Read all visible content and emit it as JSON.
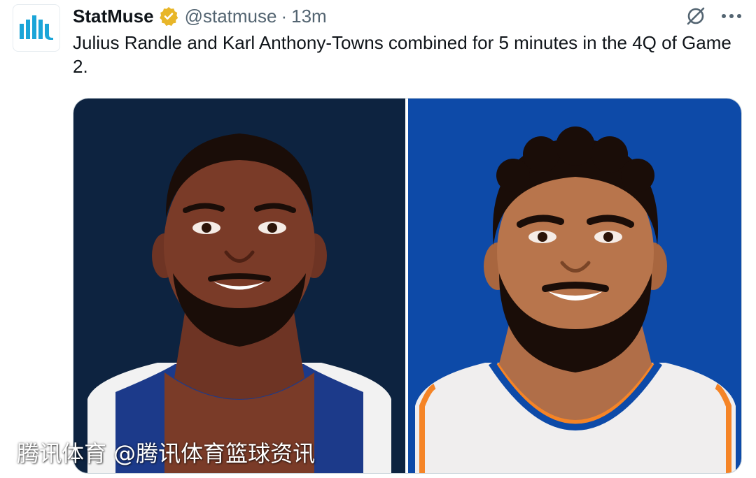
{
  "tweet": {
    "display_name": "StatMuse",
    "handle": "@statmuse",
    "separator": "·",
    "time": "13m",
    "text": "Julius Randle and Karl Anthony-Towns combined for 5 minutes in the 4Q of Game 2.",
    "media_alt": [
      "Julius Randle",
      "Karl Anthony-Towns"
    ]
  },
  "icons": {
    "avatar": "statmuse-logo-icon",
    "verified": "verified-badge-icon",
    "grok": "grok-icon",
    "more": "more-options-icon"
  },
  "colors": {
    "brand": "#1ba5d8",
    "verified": "#e8b629",
    "left_bg": "#0d2340",
    "right_bg": "#0d4aa8"
  },
  "watermark": {
    "text": "腾讯体育 @腾讯体育篮球资讯"
  }
}
